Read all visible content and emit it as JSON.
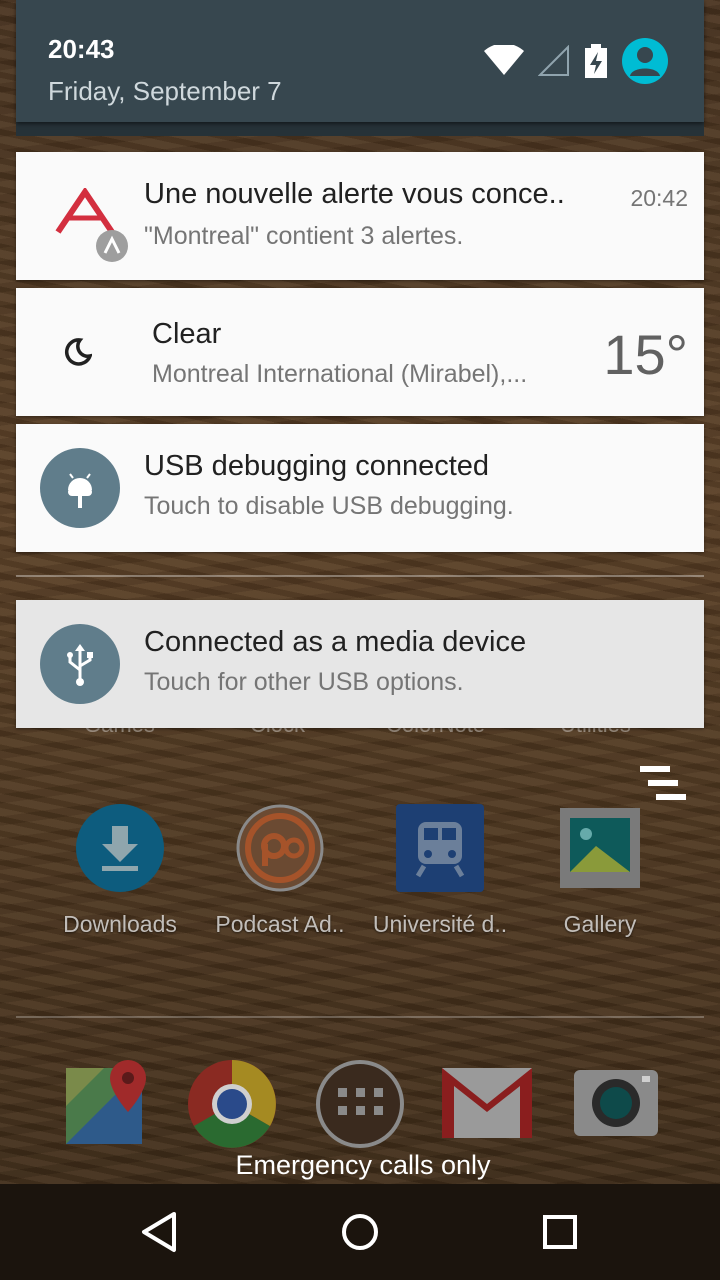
{
  "status": {
    "time": "20:43",
    "date": "Friday, September 7"
  },
  "notifications": [
    {
      "title": "Une nouvelle alerte vous conce..",
      "text": "\"Montreal\" contient 3 alertes.",
      "time": "20:42",
      "icon": "alert-app-icon"
    },
    {
      "title": "Clear",
      "text": "Montreal International (Mirabel),...",
      "temperature": "15°",
      "icon": "moon-icon"
    },
    {
      "title": "USB debugging connected",
      "text": "Touch to disable USB debugging.",
      "icon": "android-debug-icon"
    },
    {
      "title": "Connected as a media device",
      "text": "Touch for other USB options.",
      "icon": "usb-icon"
    }
  ],
  "home": {
    "faded_labels": [
      "Games",
      "Clock",
      "ColorNote",
      "Utilities"
    ],
    "apps": [
      {
        "label": "Downloads",
        "icon": "download-icon"
      },
      {
        "label": "Podcast Ad..",
        "icon": "podcast-icon"
      },
      {
        "label": "Université d..",
        "icon": "train-icon"
      },
      {
        "label": "Gallery",
        "icon": "gallery-icon"
      }
    ],
    "dock": [
      "maps-icon",
      "chrome-icon",
      "app-drawer-icon",
      "gmail-icon",
      "camera-icon"
    ]
  },
  "lockscreen": {
    "emergency": "Emergency calls only"
  },
  "colors": {
    "header_bg": "#37474f",
    "card_bg": "#fafafa",
    "accent_avatar": "#00bcd4",
    "icon_bg": "#607d8b"
  }
}
